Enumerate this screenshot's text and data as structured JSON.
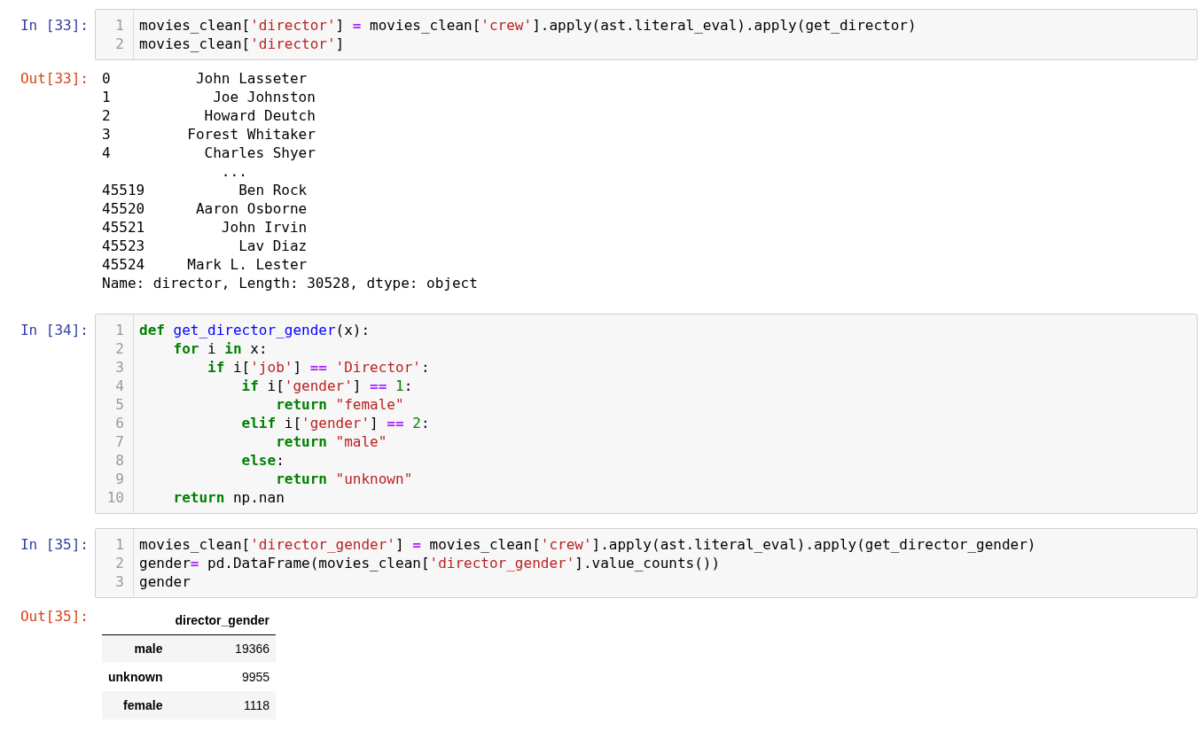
{
  "cells": [
    {
      "prompt": "In [33]:",
      "lines": [
        {
          "n": "1",
          "tokens": [
            {
              "kind": "plain",
              "text": "movies_clean["
            },
            {
              "kind": "str",
              "text": "'director'"
            },
            {
              "kind": "plain",
              "text": "] "
            },
            {
              "kind": "op",
              "text": "="
            },
            {
              "kind": "plain",
              "text": " movies_clean["
            },
            {
              "kind": "str",
              "text": "'crew'"
            },
            {
              "kind": "plain",
              "text": "].apply(ast.literal_eval).apply(get_director)"
            }
          ]
        },
        {
          "n": "2",
          "tokens": [
            {
              "kind": "plain",
              "text": "movies_clean["
            },
            {
              "kind": "str",
              "text": "'director'"
            },
            {
              "kind": "plain",
              "text": "]"
            }
          ]
        }
      ],
      "output": {
        "prompt": "Out[33]:",
        "kind": "text",
        "lines": [
          "0          John Lasseter",
          "1            Joe Johnston",
          "2           Howard Deutch",
          "3         Forest Whitaker",
          "4           Charles Shyer",
          "              ...",
          "45519           Ben Rock",
          "45520      Aaron Osborne",
          "45521         John Irvin",
          "45523           Lav Diaz",
          "45524     Mark L. Lester",
          "Name: director, Length: 30528, dtype: object"
        ]
      }
    },
    {
      "prompt": "In [34]:",
      "lines": [
        {
          "n": "1",
          "tokens": [
            {
              "kind": "kw",
              "text": "def "
            },
            {
              "kind": "fn",
              "text": "get_director_gender"
            },
            {
              "kind": "plain",
              "text": "(x):"
            }
          ]
        },
        {
          "n": "2",
          "tokens": [
            {
              "kind": "kw",
              "text": "    for"
            },
            {
              "kind": "plain",
              "text": " i "
            },
            {
              "kind": "kw",
              "text": "in"
            },
            {
              "kind": "plain",
              "text": " x:"
            }
          ]
        },
        {
          "n": "3",
          "tokens": [
            {
              "kind": "kw",
              "text": "        if"
            },
            {
              "kind": "plain",
              "text": " i["
            },
            {
              "kind": "str",
              "text": "'job'"
            },
            {
              "kind": "plain",
              "text": "] "
            },
            {
              "kind": "op",
              "text": "== "
            },
            {
              "kind": "str",
              "text": "'Director'"
            },
            {
              "kind": "plain",
              "text": ":"
            }
          ]
        },
        {
          "n": "4",
          "tokens": [
            {
              "kind": "kw",
              "text": "            if"
            },
            {
              "kind": "plain",
              "text": " i["
            },
            {
              "kind": "str",
              "text": "'gender'"
            },
            {
              "kind": "plain",
              "text": "] "
            },
            {
              "kind": "op",
              "text": "== "
            },
            {
              "kind": "num",
              "text": "1"
            },
            {
              "kind": "plain",
              "text": ":"
            }
          ]
        },
        {
          "n": "5",
          "tokens": [
            {
              "kind": "kw",
              "text": "                return "
            },
            {
              "kind": "str",
              "text": "\"female\""
            }
          ]
        },
        {
          "n": "6",
          "tokens": [
            {
              "kind": "kw",
              "text": "            elif"
            },
            {
              "kind": "plain",
              "text": " i["
            },
            {
              "kind": "str",
              "text": "'gender'"
            },
            {
              "kind": "plain",
              "text": "] "
            },
            {
              "kind": "op",
              "text": "== "
            },
            {
              "kind": "num",
              "text": "2"
            },
            {
              "kind": "plain",
              "text": ":"
            }
          ]
        },
        {
          "n": "7",
          "tokens": [
            {
              "kind": "kw",
              "text": "                return "
            },
            {
              "kind": "str",
              "text": "\"male\""
            }
          ]
        },
        {
          "n": "8",
          "tokens": [
            {
              "kind": "kw",
              "text": "            else"
            },
            {
              "kind": "plain",
              "text": ":"
            }
          ]
        },
        {
          "n": "9",
          "tokens": [
            {
              "kind": "kw",
              "text": "                return "
            },
            {
              "kind": "str",
              "text": "\"unknown\""
            }
          ]
        },
        {
          "n": "10",
          "tokens": [
            {
              "kind": "kw",
              "text": "    return"
            },
            {
              "kind": "plain",
              "text": " np.nan"
            }
          ]
        }
      ]
    },
    {
      "prompt": "In [35]:",
      "lines": [
        {
          "n": "1",
          "tokens": [
            {
              "kind": "plain",
              "text": "movies_clean["
            },
            {
              "kind": "str",
              "text": "'director_gender'"
            },
            {
              "kind": "plain",
              "text": "] "
            },
            {
              "kind": "op",
              "text": "="
            },
            {
              "kind": "plain",
              "text": " movies_clean["
            },
            {
              "kind": "str",
              "text": "'crew'"
            },
            {
              "kind": "plain",
              "text": "].apply(ast.literal_eval).apply(get_director_gender)"
            }
          ]
        },
        {
          "n": "2",
          "tokens": [
            {
              "kind": "plain",
              "text": "gender"
            },
            {
              "kind": "op",
              "text": "="
            },
            {
              "kind": "plain",
              "text": " pd.DataFrame(movies_clean["
            },
            {
              "kind": "str",
              "text": "'director_gender'"
            },
            {
              "kind": "plain",
              "text": "].value_counts())"
            }
          ]
        },
        {
          "n": "3",
          "tokens": [
            {
              "kind": "plain",
              "text": "gender"
            }
          ]
        }
      ],
      "output": {
        "prompt": "Out[35]:",
        "kind": "table",
        "header": "director_gender",
        "rows": [
          {
            "label": "male",
            "value": "19366"
          },
          {
            "label": "unknown",
            "value": "9955"
          },
          {
            "label": "female",
            "value": "1118"
          }
        ]
      }
    }
  ]
}
